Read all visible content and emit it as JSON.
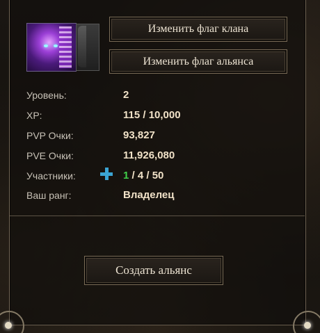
{
  "buttons": {
    "change_clan_flag": "Изменить флаг клана",
    "change_alliance_flag": "Изменить флаг альянса",
    "create_alliance": "Создать альянс"
  },
  "stats": [
    {
      "label": "Уровень:",
      "value": "2"
    },
    {
      "label": "XP:",
      "value": "115 / 10,000"
    },
    {
      "label": "PVP Очки:",
      "value": "93,827"
    },
    {
      "label": "PVE Очки:",
      "value": "11,926,080"
    },
    {
      "label": "Участники:",
      "value_green": "1",
      "value_rest": " / 4 / 50"
    },
    {
      "label": "Ваш ранг:",
      "value": "Владелец"
    }
  ],
  "icons": {
    "add_member": "plus-icon",
    "clan_emblem": "clan-emblem-image",
    "flag_slot": "flag-slot"
  },
  "colors": {
    "accent_plus": "#3ba4d3",
    "members_green": "#3fd04a",
    "value_text": "#f1e2c8",
    "label_text": "#c8c2b7"
  }
}
